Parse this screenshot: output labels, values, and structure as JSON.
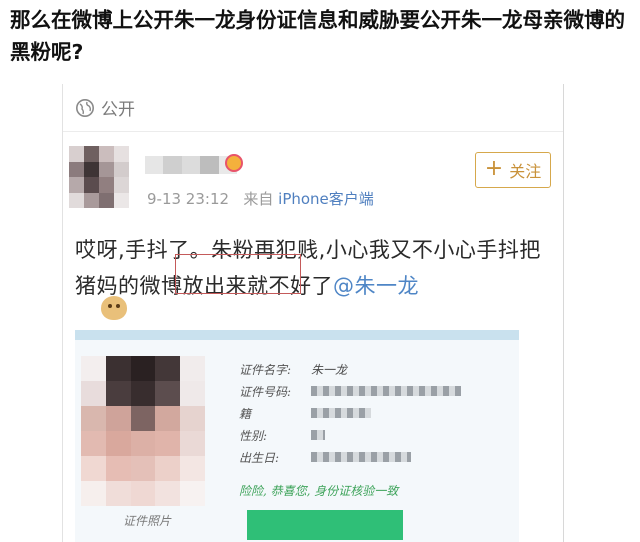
{
  "headline": "那么在微博上公开朱一龙身份证信息和威胁要公开朱一龙母亲微博的黑粉呢?",
  "post": {
    "visibility_label": "公开",
    "follow_label": "关注",
    "timestamp": "9-13 23:12",
    "source_prefix": "来自",
    "source_client": "iPhone客户端",
    "text_before_mention": "哎呀,手抖了。朱粉再犯贱,小心我又不小心手抖把猪妈的微博放出来就不好了",
    "mention": "@朱一龙",
    "emoji": "doge"
  },
  "id_card": {
    "fields": [
      {
        "label": "证件名字:",
        "value": "朱一龙"
      },
      {
        "label": "证件号码:",
        "value": ""
      },
      {
        "label": "籍",
        "value": ""
      },
      {
        "label": "性别:",
        "value": ""
      },
      {
        "label": "出生日:",
        "value": ""
      }
    ],
    "warning": "险险, 恭喜您, 身份证核验一致",
    "photo_caption": "证件照片"
  },
  "colors": {
    "mention_blue": "#4f86c6",
    "follow_gold": "#c9923a",
    "highlight_red": "#c45a5a",
    "verify_green": "#2fbf77"
  }
}
